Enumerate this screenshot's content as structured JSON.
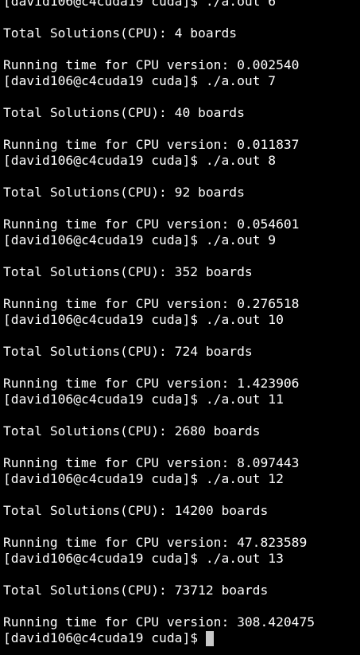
{
  "terminal": {
    "lines": [
      "[david106@c4cuda19 cuda]$ ./a.out 6",
      "",
      "Total Solutions(CPU): 4 boards",
      "",
      "Running time for CPU version: 0.002540",
      "[david106@c4cuda19 cuda]$ ./a.out 7",
      "",
      "Total Solutions(CPU): 40 boards",
      "",
      "Running time for CPU version: 0.011837",
      "[david106@c4cuda19 cuda]$ ./a.out 8",
      "",
      "Total Solutions(CPU): 92 boards",
      "",
      "Running time for CPU version: 0.054601",
      "[david106@c4cuda19 cuda]$ ./a.out 9",
      "",
      "Total Solutions(CPU): 352 boards",
      "",
      "Running time for CPU version: 0.276518",
      "[david106@c4cuda19 cuda]$ ./a.out 10",
      "",
      "Total Solutions(CPU): 724 boards",
      "",
      "Running time for CPU version: 1.423906",
      "[david106@c4cuda19 cuda]$ ./a.out 11",
      "",
      "Total Solutions(CPU): 2680 boards",
      "",
      "Running time for CPU version: 8.097443",
      "[david106@c4cuda19 cuda]$ ./a.out 12",
      "",
      "Total Solutions(CPU): 14200 boards",
      "",
      "Running time for CPU version: 47.823589",
      "[david106@c4cuda19 cuda]$ ./a.out 13",
      "",
      "Total Solutions(CPU): 73712 boards",
      "",
      "Running time for CPU version: 308.420475"
    ],
    "prompt": "[david106@c4cuda19 cuda]$",
    "colors": {
      "background": "#000000",
      "text": "#ffffff",
      "cursor": "#c8c8c8"
    }
  }
}
